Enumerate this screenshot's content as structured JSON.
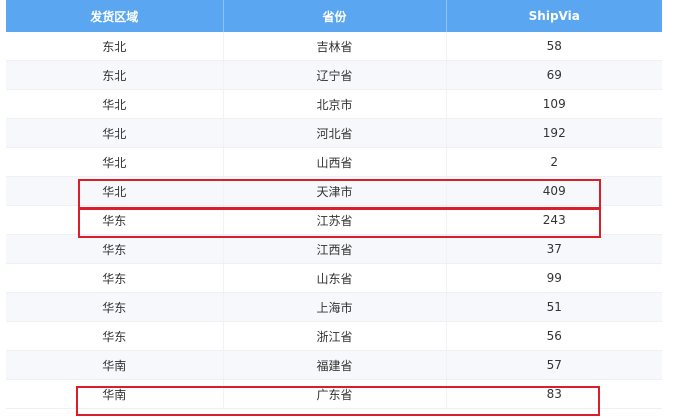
{
  "table": {
    "headers": [
      "发货区域",
      "省份",
      "ShipVia"
    ],
    "rows": [
      [
        "东北",
        "吉林省",
        "58"
      ],
      [
        "东北",
        "辽宁省",
        "69"
      ],
      [
        "华北",
        "北京市",
        "109"
      ],
      [
        "华北",
        "河北省",
        "192"
      ],
      [
        "华北",
        "山西省",
        "2"
      ],
      [
        "华北",
        "天津市",
        "409"
      ],
      [
        "华东",
        "江苏省",
        "243"
      ],
      [
        "华东",
        "江西省",
        "37"
      ],
      [
        "华东",
        "山东省",
        "99"
      ],
      [
        "华东",
        "上海市",
        "51"
      ],
      [
        "华东",
        "浙江省",
        "56"
      ],
      [
        "华南",
        "福建省",
        "57"
      ],
      [
        "华南",
        "广东省",
        "83"
      ]
    ]
  },
  "colors": {
    "header_bg": "#5aa6f0",
    "highlight_border": "#d9202a"
  }
}
